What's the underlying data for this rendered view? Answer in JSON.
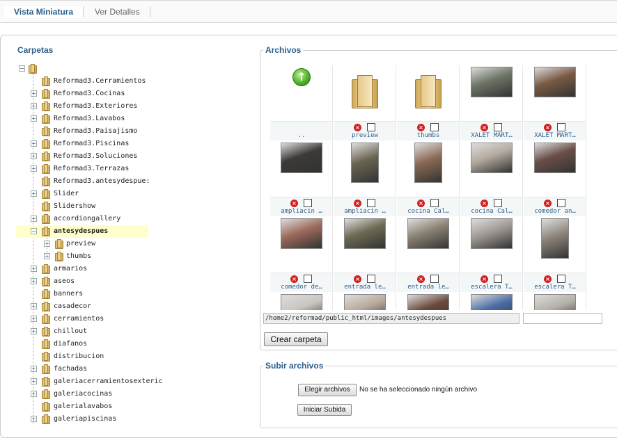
{
  "tabs": [
    {
      "label": "Vista Miniatura"
    },
    {
      "label": "Ver Detalles"
    }
  ],
  "sidebar": {
    "title": "Carpetas",
    "items": [
      {
        "label": "Reformad3.Cerramientos",
        "expander": false
      },
      {
        "label": "Reformad3.Cocinas",
        "expander": true
      },
      {
        "label": "Reformad3.Exteriores",
        "expander": true
      },
      {
        "label": "Reformad3.Lavabos",
        "expander": true
      },
      {
        "label": "Reformad3.Paisajismo",
        "expander": false
      },
      {
        "label": "Reformad3.Piscinas",
        "expander": true
      },
      {
        "label": "Reformad3.Soluciones",
        "expander": true
      },
      {
        "label": "Reformad3.Terrazas",
        "expander": true
      },
      {
        "label": "Reformad3.antesydespue:",
        "expander": false
      },
      {
        "label": "Slider",
        "expander": true
      },
      {
        "label": "Slidershow",
        "expander": false
      },
      {
        "label": "accordiongallery",
        "expander": true
      },
      {
        "label": "antesydespues",
        "expander": true,
        "selected": true
      },
      {
        "label": "preview",
        "expander": true,
        "child": true
      },
      {
        "label": "thumbs",
        "expander": true,
        "child": true
      },
      {
        "label": "armarios",
        "expander": true
      },
      {
        "label": "aseos",
        "expander": true
      },
      {
        "label": "banners",
        "expander": false
      },
      {
        "label": "casadecor",
        "expander": true
      },
      {
        "label": "cerramientos",
        "expander": true
      },
      {
        "label": "chillout",
        "expander": true
      },
      {
        "label": "diafanos",
        "expander": false
      },
      {
        "label": "distribucion",
        "expander": false
      },
      {
        "label": "fachadas",
        "expander": true
      },
      {
        "label": "galeriacerramientosexteric",
        "expander": true
      },
      {
        "label": "galeriacocinas",
        "expander": true
      },
      {
        "label": "galerialavabos",
        "expander": false
      },
      {
        "label": "galeriapiscinas",
        "expander": true
      }
    ]
  },
  "files": {
    "title": "Archivos",
    "row1": [
      {
        "name": "..",
        "kind": "up"
      },
      {
        "name": "preview",
        "kind": "folder"
      },
      {
        "name": "thumbs",
        "kind": "folder"
      },
      {
        "name": "XALET MART…",
        "kind": "image",
        "color": "#6d7566"
      },
      {
        "name": "XALET MART…",
        "kind": "image",
        "color": "#7a5a44"
      }
    ],
    "row2": [
      {
        "name": "ampliacin …",
        "color": "#3c3a36"
      },
      {
        "name": "ampliacin …",
        "color": "#6a6552"
      },
      {
        "name": "cocina Cal…",
        "color": "#8a6a55"
      },
      {
        "name": "cocina Cal…",
        "color": "#b5aba0"
      },
      {
        "name": "comedor an…",
        "color": "#6a4e48"
      }
    ],
    "row3": [
      {
        "name": "comedor de…",
        "color": "#9d6a5a"
      },
      {
        "name": "entrada le…",
        "color": "#6c6a52"
      },
      {
        "name": "entrada le…",
        "color": "#8a8172"
      },
      {
        "name": "escalera T…",
        "color": "#a09a94"
      },
      {
        "name": "escalera T…",
        "color": "#8d857b"
      }
    ],
    "row4": [
      {
        "color": "#c9c6c1"
      },
      {
        "color": "#b8a99a"
      },
      {
        "color": "#6b4a3c"
      },
      {
        "color": "#4a6ba5"
      },
      {
        "color": "#b3b0a6"
      }
    ],
    "path": "/home2/reformad/public_html/images/antesydespues",
    "new_folder_name": "",
    "create_button": "Crear carpeta"
  },
  "upload": {
    "title": "Subir archivos",
    "choose_button": "Elegir archivos",
    "no_file_text": "No se ha seleccionado ningún archivo",
    "start_button": "Iniciar Subida"
  }
}
